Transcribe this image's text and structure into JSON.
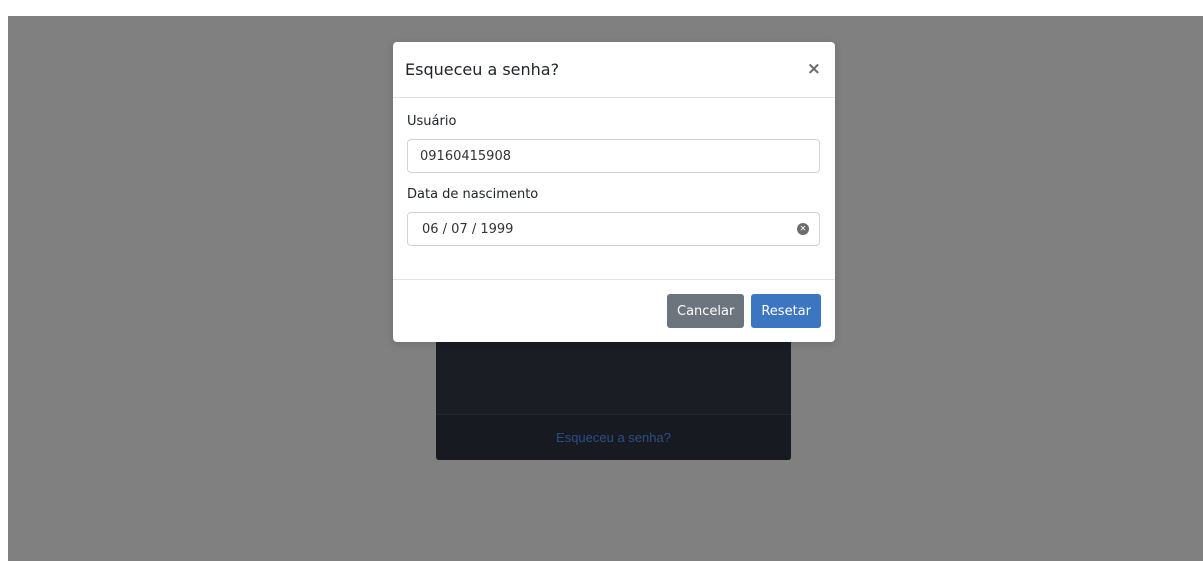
{
  "background": {
    "login_card": {
      "forgot_link": "Esqueceu a senha?"
    }
  },
  "modal": {
    "title": "Esqueceu a senha?",
    "close_icon": "close-icon",
    "fields": {
      "user": {
        "label": "Usuário",
        "value": "09160415908"
      },
      "birth_date": {
        "label": "Data de nascimento",
        "value": "06 / 07 / 1999",
        "clear_icon": "clear-icon"
      }
    },
    "buttons": {
      "cancel": "Cancelar",
      "reset": "Resetar"
    }
  },
  "colors": {
    "overlay": "#808080",
    "primary": "#3c75c0",
    "secondary": "#6c757d",
    "link": "#2b4d87"
  }
}
